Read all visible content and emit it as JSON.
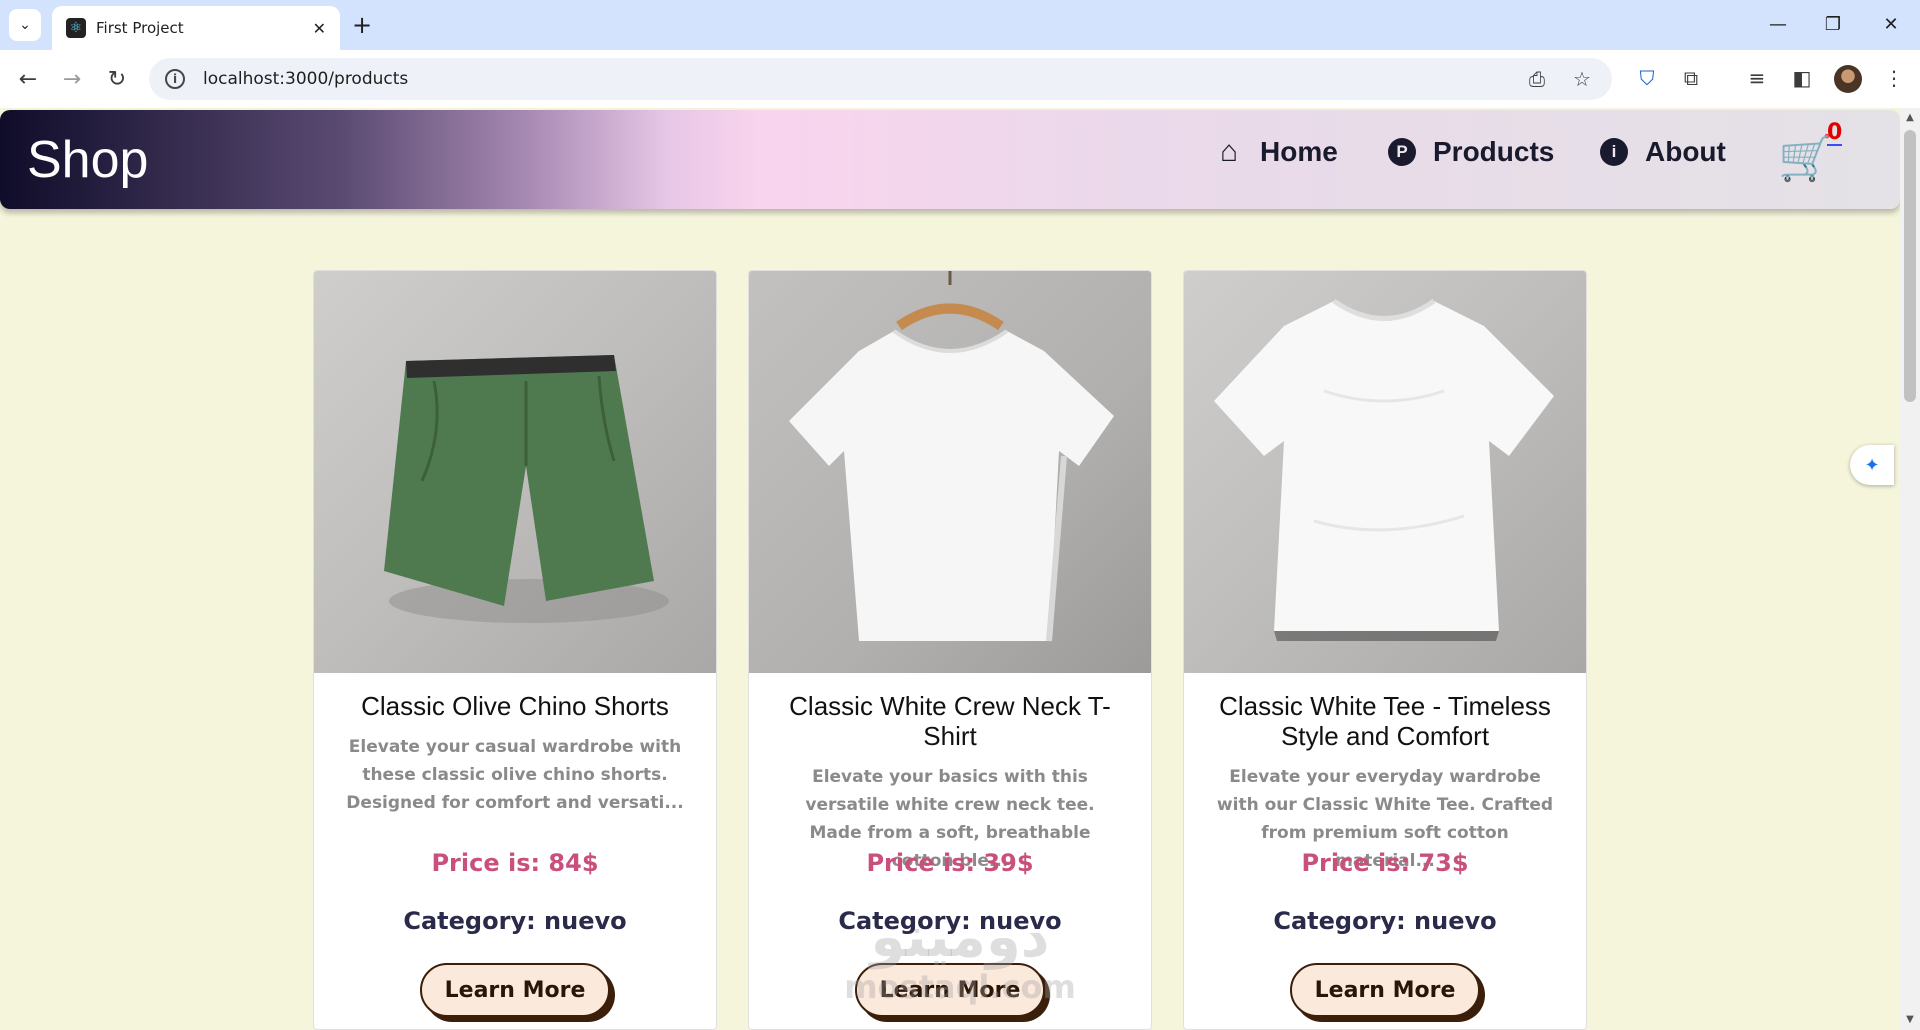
{
  "browser": {
    "tab_title": "First Project",
    "url": "localhost:3000/products",
    "new_tab_glyph": "+",
    "tab_close_glyph": "✕",
    "minimize_glyph": "—",
    "restore_glyph": "❐",
    "close_glyph": "✕"
  },
  "header": {
    "logo": "Shop",
    "nav": [
      {
        "label": "Home",
        "icon": "house-icon"
      },
      {
        "label": "Products",
        "icon": "p-circle-icon"
      },
      {
        "label": "About",
        "icon": "info-circle-icon"
      }
    ],
    "cart_count": "0"
  },
  "products": [
    {
      "title": "Classic Olive Chino Shorts",
      "description": "Elevate your casual wardrobe with these classic olive chino shorts. Designed for comfort and versati...",
      "price": "Price is: 84$",
      "category": "Category: nuevo",
      "button": "Learn More"
    },
    {
      "title": "Classic White Crew Neck T-Shirt",
      "description": "Elevate your basics with this versatile white crew neck tee. Made from a soft, breathable cotton ble...",
      "price": "Price is: 39$",
      "category": "Category: nuevo",
      "button": "Learn More"
    },
    {
      "title": "Classic White Tee - Timeless Style and Comfort",
      "description": "Elevate your everyday wardrobe with our Classic White Tee. Crafted from premium soft cotton material...",
      "price": "Price is: 73$",
      "category": "Category: nuevo",
      "button": "Learn More"
    }
  ],
  "colors": {
    "page_bg": "#f5f5dc",
    "price": "#c94f7c",
    "category": "#2a2a4a",
    "button_bg": "#fbe9dc",
    "cart_badge": "#e00000"
  }
}
